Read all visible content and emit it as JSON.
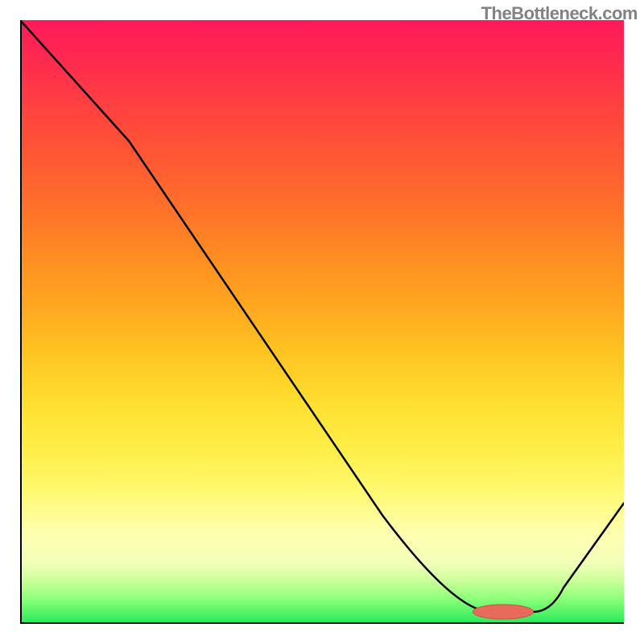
{
  "chart_data": {
    "type": "line",
    "title": "",
    "xlabel": "",
    "ylabel": "",
    "watermark": "TheBottleneck.com",
    "xlim": [
      0,
      100
    ],
    "ylim": [
      0,
      100
    ],
    "series": [
      {
        "name": "curve",
        "x": [
          0,
          18,
          60,
          78,
          85,
          100
        ],
        "values": [
          100,
          80,
          18,
          2,
          2,
          20
        ]
      }
    ],
    "marker": {
      "x": 80,
      "y": 2,
      "color": "#e86a5a",
      "radius_x": 5,
      "radius_y": 1.2
    },
    "gradient_stops": [
      {
        "pos": 0,
        "color": "#ff1a5a"
      },
      {
        "pos": 50,
        "color": "#ffd028"
      },
      {
        "pos": 80,
        "color": "#ffff80"
      },
      {
        "pos": 100,
        "color": "#26e858"
      }
    ]
  }
}
